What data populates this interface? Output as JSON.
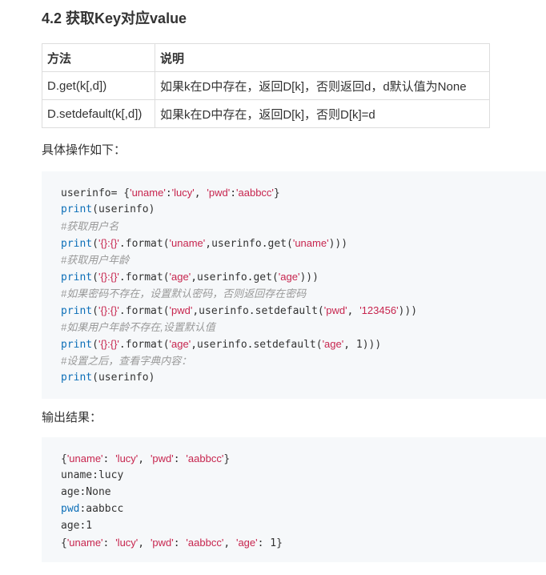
{
  "heading": "4.2 获取Key对应value",
  "table": {
    "headers": [
      "方法",
      "说明"
    ],
    "rows": [
      [
        "D.get(k[,d])",
        "如果k在D中存在，返回D[k]，否则返回d，d默认值为None"
      ],
      [
        "D.setdefault(k[,d])",
        "如果k在D中存在，返回D[k]，否则D[k]=d"
      ]
    ]
  },
  "operations_label": "具体操作如下：",
  "output_label": "输出结果：",
  "code_lines": [
    [
      {
        "t": "userinfo= {",
        "c": "pl"
      },
      {
        "t": "'uname'",
        "c": "str"
      },
      {
        "t": ":",
        "c": "pl"
      },
      {
        "t": "'lucy'",
        "c": "str"
      },
      {
        "t": ", ",
        "c": "pl"
      },
      {
        "t": "'pwd'",
        "c": "str"
      },
      {
        "t": ":",
        "c": "pl"
      },
      {
        "t": "'aabbcc'",
        "c": "str"
      },
      {
        "t": "}",
        "c": "pl"
      }
    ],
    [
      {
        "t": "print",
        "c": "kw"
      },
      {
        "t": "(userinfo)",
        "c": "pl"
      }
    ],
    [
      {
        "t": "#获取用户名",
        "c": "cm"
      }
    ],
    [
      {
        "t": "print",
        "c": "kw"
      },
      {
        "t": "(",
        "c": "pl"
      },
      {
        "t": "'{}:{}'",
        "c": "str"
      },
      {
        "t": ".format(",
        "c": "pl"
      },
      {
        "t": "'uname'",
        "c": "str"
      },
      {
        "t": ",userinfo.get(",
        "c": "pl"
      },
      {
        "t": "'uname'",
        "c": "str"
      },
      {
        "t": ")))",
        "c": "pl"
      }
    ],
    [
      {
        "t": "#获取用户年龄",
        "c": "cm"
      }
    ],
    [
      {
        "t": "print",
        "c": "kw"
      },
      {
        "t": "(",
        "c": "pl"
      },
      {
        "t": "'{}:{}'",
        "c": "str"
      },
      {
        "t": ".format(",
        "c": "pl"
      },
      {
        "t": "'age'",
        "c": "str"
      },
      {
        "t": ",userinfo.get(",
        "c": "pl"
      },
      {
        "t": "'age'",
        "c": "str"
      },
      {
        "t": ")))",
        "c": "pl"
      }
    ],
    [
      {
        "t": "#如果密码不存在，设置默认密码，否则返回存在密码",
        "c": "cm"
      }
    ],
    [
      {
        "t": "print",
        "c": "kw"
      },
      {
        "t": "(",
        "c": "pl"
      },
      {
        "t": "'{}:{}'",
        "c": "str"
      },
      {
        "t": ".format(",
        "c": "pl"
      },
      {
        "t": "'pwd'",
        "c": "str"
      },
      {
        "t": ",userinfo.setdefault(",
        "c": "pl"
      },
      {
        "t": "'pwd'",
        "c": "str"
      },
      {
        "t": ", ",
        "c": "pl"
      },
      {
        "t": "'123456'",
        "c": "str"
      },
      {
        "t": ")))",
        "c": "pl"
      }
    ],
    [
      {
        "t": "#如果用户年龄不存在,设置默认值",
        "c": "cm"
      }
    ],
    [
      {
        "t": "print",
        "c": "kw"
      },
      {
        "t": "(",
        "c": "pl"
      },
      {
        "t": "'{}:{}'",
        "c": "str"
      },
      {
        "t": ".format(",
        "c": "pl"
      },
      {
        "t": "'age'",
        "c": "str"
      },
      {
        "t": ",userinfo.setdefault(",
        "c": "pl"
      },
      {
        "t": "'age'",
        "c": "str"
      },
      {
        "t": ", 1)))",
        "c": "pl"
      }
    ],
    [
      {
        "t": "#设置之后，查看字典内容：",
        "c": "cm"
      }
    ],
    [
      {
        "t": "print",
        "c": "kw"
      },
      {
        "t": "(userinfo)",
        "c": "pl"
      }
    ]
  ],
  "output_lines": [
    [
      {
        "t": "{",
        "c": "pl"
      },
      {
        "t": "'uname'",
        "c": "str"
      },
      {
        "t": ": ",
        "c": "pl"
      },
      {
        "t": "'lucy'",
        "c": "str"
      },
      {
        "t": ", ",
        "c": "pl"
      },
      {
        "t": "'pwd'",
        "c": "str"
      },
      {
        "t": ": ",
        "c": "pl"
      },
      {
        "t": "'aabbcc'",
        "c": "str"
      },
      {
        "t": "}",
        "c": "pl"
      }
    ],
    [
      {
        "t": "uname:lucy",
        "c": "pl"
      }
    ],
    [
      {
        "t": "age:None",
        "c": "pl"
      }
    ],
    [
      {
        "t": "pwd",
        "c": "kw"
      },
      {
        "t": ":aabbcc",
        "c": "pl"
      }
    ],
    [
      {
        "t": "age:1",
        "c": "pl"
      }
    ],
    [
      {
        "t": "{",
        "c": "pl"
      },
      {
        "t": "'uname'",
        "c": "str"
      },
      {
        "t": ": ",
        "c": "pl"
      },
      {
        "t": "'lucy'",
        "c": "str"
      },
      {
        "t": ", ",
        "c": "pl"
      },
      {
        "t": "'pwd'",
        "c": "str"
      },
      {
        "t": ": ",
        "c": "pl"
      },
      {
        "t": "'aabbcc'",
        "c": "str"
      },
      {
        "t": ", ",
        "c": "pl"
      },
      {
        "t": "'age'",
        "c": "str"
      },
      {
        "t": ": 1}",
        "c": "pl"
      }
    ]
  ],
  "colors": {
    "keyword": "#0d6fb8",
    "string": "#c7254e",
    "comment": "#999999",
    "code_background": "#f6f8fa",
    "table_border": "#dddddd"
  }
}
